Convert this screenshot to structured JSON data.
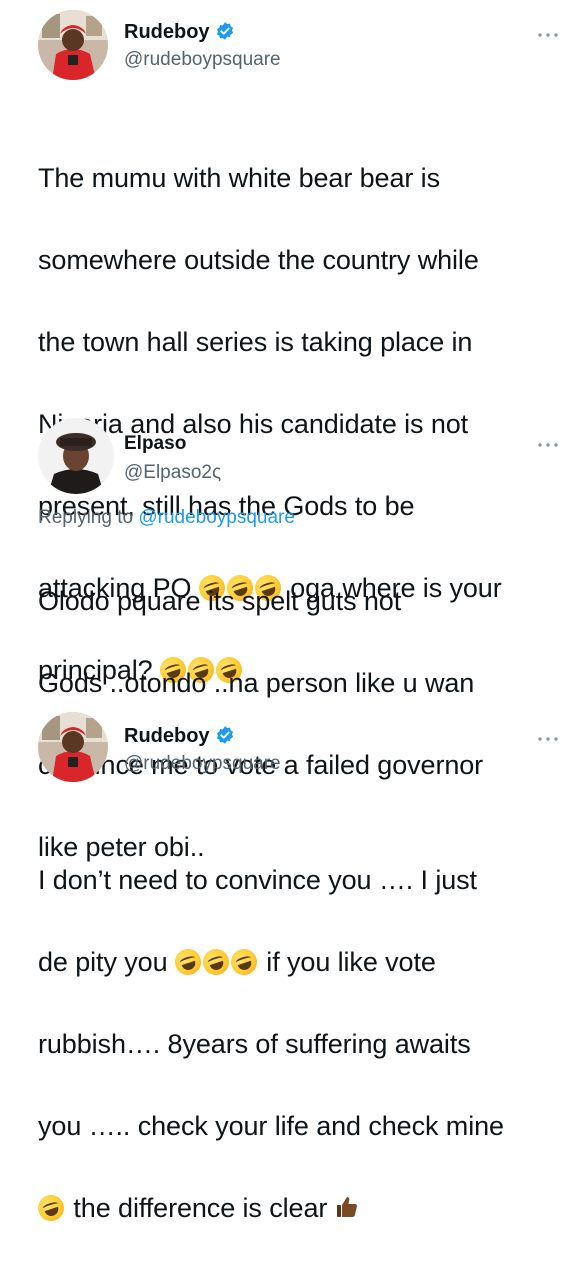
{
  "tweets": [
    {
      "display_name": "Rudeboy",
      "handle": "@rudeboypsquare",
      "text_lines": [
        "The mumu with white bear bear is",
        "somewhere outside the country while",
        "the town hall series is taking place in",
        "Nigeria and also his candidate is not",
        "present,  still has the Gods to be",
        "attacking PO",
        "oga where is your",
        "principal?"
      ]
    },
    {
      "display_name": "Elpaso",
      "handle": "@Elpaso2ς",
      "reply_label": "Replying to",
      "reply_mention": "@rudeboypsquare",
      "text_lines": [
        "Olodo pquare its spelt guts not",
        "Gods ..otondo ..na person like u wan",
        "convince me to vote a failed governor",
        "like peter obi.."
      ]
    },
    {
      "display_name": "Rudeboy",
      "handle": "@rudeboypsquare",
      "text_lines": [
        "I don’t need to convince you …. I just",
        "de pity you",
        "if you like vote",
        "rubbish…. 8years of suffering awaits",
        "you ….. check your life and check mine",
        "the difference is clear"
      ]
    }
  ],
  "icons": {
    "verified": "verified-badge-icon",
    "more": "more-options-icon",
    "laugh_emoji": "rolling-on-floor-laughing-emoji",
    "thumbs_up": "thumbs-up-emoji"
  },
  "colors": {
    "text": "#0f1419",
    "secondary": "#536471",
    "accent": "#1d9bf0"
  }
}
